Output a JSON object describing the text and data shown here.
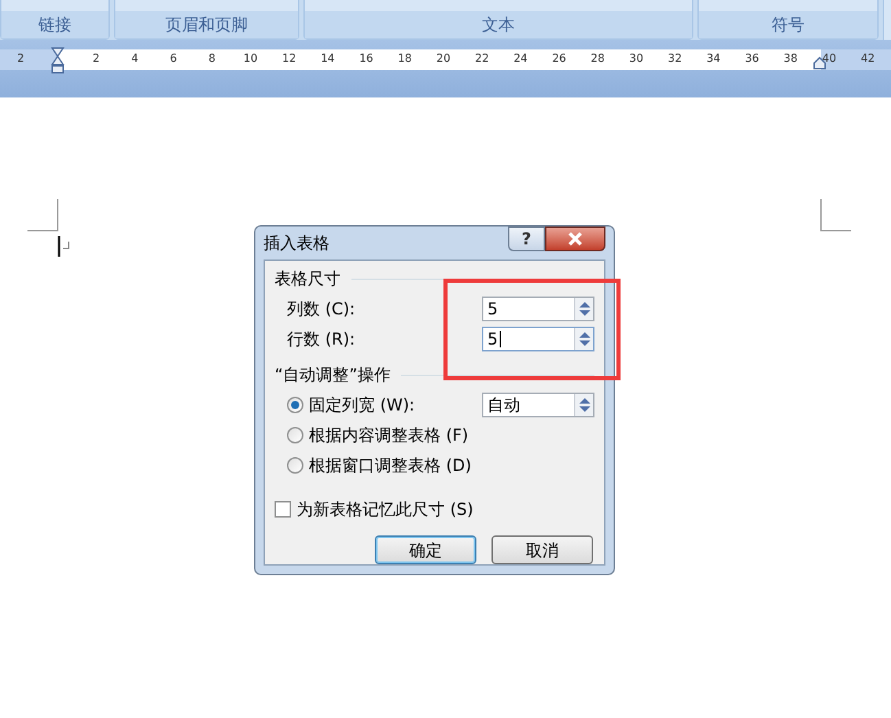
{
  "ribbon_groups": [
    {
      "label": "链接"
    },
    {
      "label": "页眉和页脚"
    },
    {
      "label": "文本"
    },
    {
      "label": "符号"
    }
  ],
  "ruler_labels": [
    "2",
    "2",
    "4",
    "6",
    "8",
    "10",
    "12",
    "14",
    "16",
    "18",
    "20",
    "22",
    "24",
    "26",
    "28",
    "30",
    "32",
    "34",
    "36",
    "38",
    "40",
    "42"
  ],
  "dialog": {
    "title": "插入表格",
    "help": "?",
    "size_section": {
      "title": "表格尺寸",
      "fields": [
        {
          "label": "列数 (C):",
          "value": "5",
          "focused": false
        },
        {
          "label": "行数 (R):",
          "value": "5",
          "focused": true
        }
      ]
    },
    "autofit_section": {
      "title": "“自动调整”操作",
      "options": [
        {
          "label": "固定列宽 (W):",
          "selected": true,
          "value": "自动"
        },
        {
          "label": "根据内容调整表格 (F)",
          "selected": false
        },
        {
          "label": "根据窗口调整表格 (D)",
          "selected": false
        }
      ]
    },
    "remember": {
      "label": "为新表格记忆此尺寸 (S)",
      "checked": false
    },
    "buttons": [
      {
        "label": "确定",
        "default": true
      },
      {
        "label": "取消",
        "default": false
      }
    ]
  }
}
